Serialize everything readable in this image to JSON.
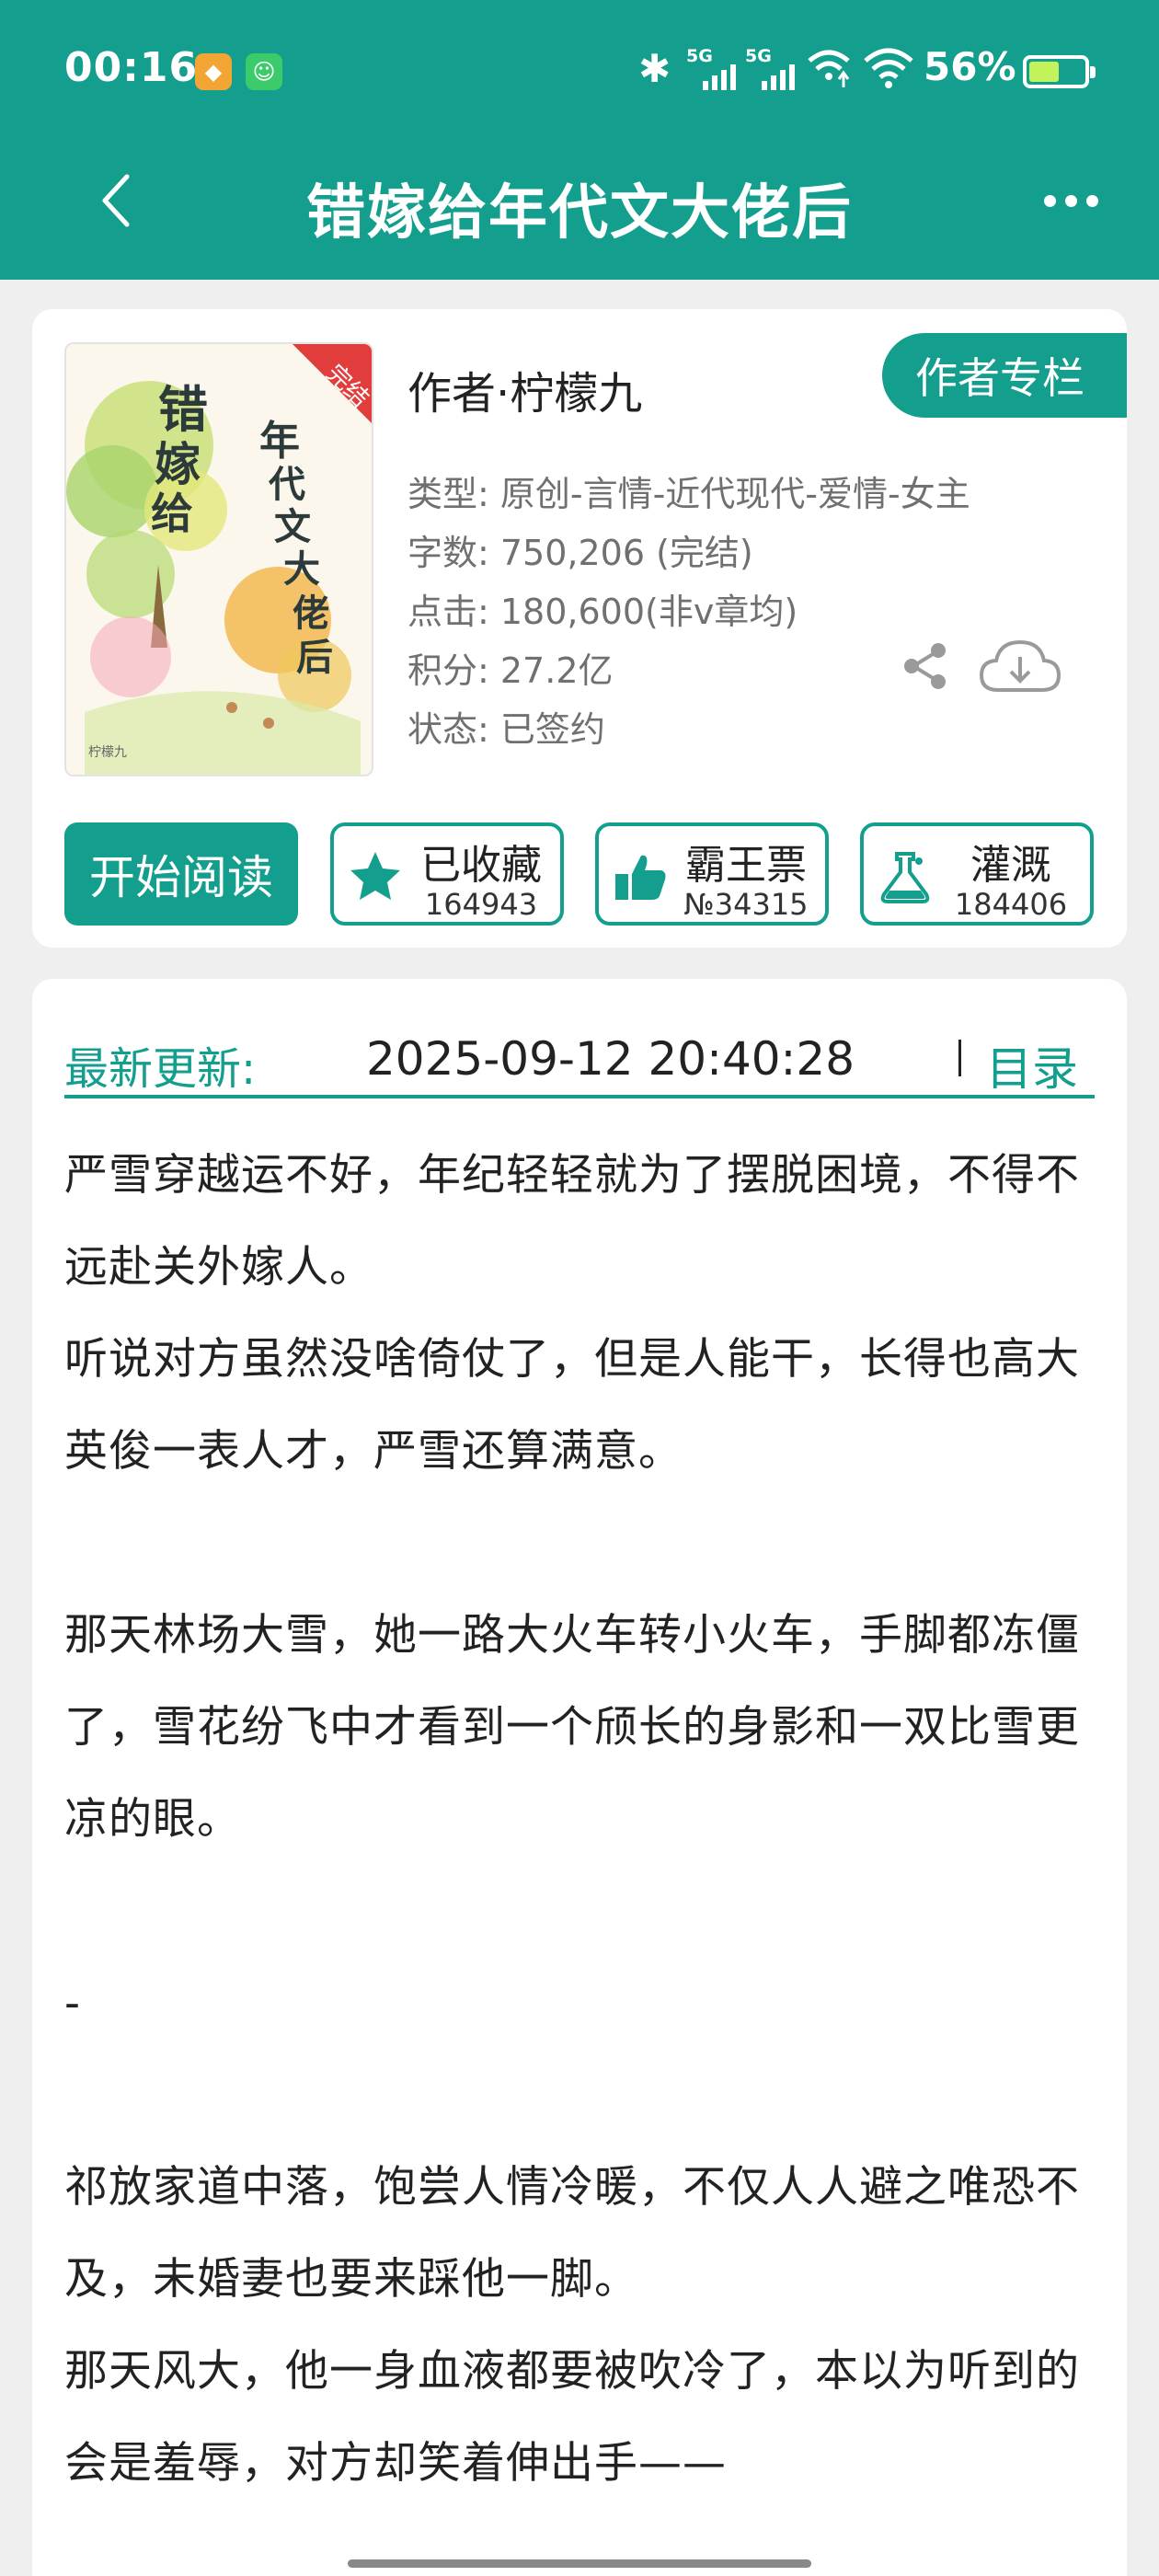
{
  "status_bar": {
    "time": "00:16",
    "network1": "5G",
    "network2": "5G",
    "battery_percent": "56%",
    "battery_level": 0.56
  },
  "header": {
    "title": "错嫁给年代文大佬后"
  },
  "book": {
    "cover": {
      "title": "错嫁给年代文大佬后",
      "badge": "完结",
      "author_mark": "柠檬九"
    },
    "author": "作者·柠檬九",
    "author_column_button": "作者专栏",
    "type": "类型: 原创-言情-近代现代-爱情-女主",
    "words": "字数: 750,206 (完结)",
    "clicks": "点击: 180,600(非v章均)",
    "score": "积分: 27.2亿",
    "status": "状态: 已签约"
  },
  "actions": {
    "read_button": "开始阅读",
    "favorite": {
      "label": "已收藏",
      "count": "164943"
    },
    "ticket": {
      "label": "霸王票",
      "count": "№34315"
    },
    "water": {
      "label": "灌溉",
      "count": "184406"
    }
  },
  "update": {
    "label": "最新更新:",
    "time": "2025-09-12 20:40:28",
    "toc_link": "目录"
  },
  "intro": {
    "p1": "严雪穿越运不好，年纪轻轻就为了摆脱困境，不得不远赴关外嫁人。",
    "p2": "听说对方虽然没啥倚仗了，但是人能干，长得也高大英俊一表人才，严雪还算满意。",
    "p3": "那天林场大雪，她一路大火车转小火车，手脚都冻僵了，雪花纷飞中才看到一个颀长的身影和一双比雪更凉的眼。",
    "p4": "-",
    "p5": "祁放家道中落，饱尝人情冷暖，不仅人人避之唯恐不及，未婚妻也要来踩他一脚。",
    "p6": "那天风大，他一身血液都要被吹冷了，本以为听到的会是羞辱，对方却笑着伸出手——"
  },
  "colors": {
    "accent": "#139e8d",
    "background": "#efefef",
    "card": "#ffffff"
  }
}
